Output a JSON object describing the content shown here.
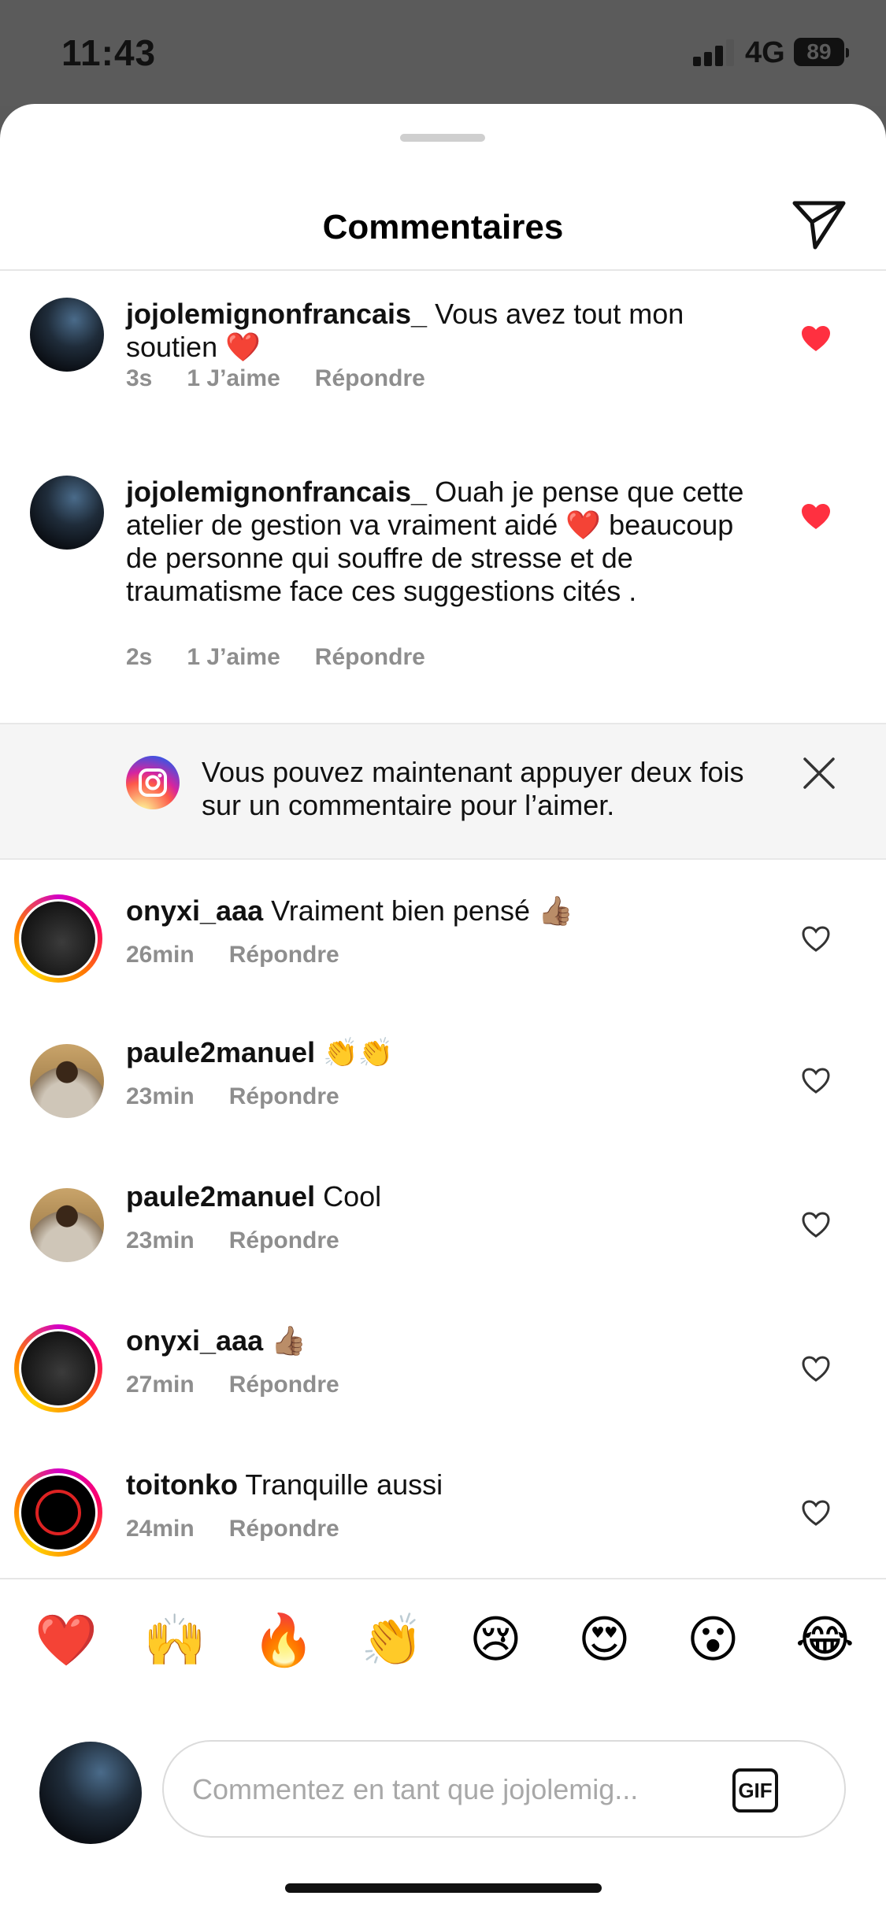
{
  "status": {
    "time": "11:43",
    "network": "4G",
    "battery": "89"
  },
  "header": {
    "title": "Commentaires",
    "share_icon": "paper-plane-icon"
  },
  "comments": [
    {
      "user": "jojolemignonfrancais_",
      "text": " Vous avez tout mon soutien ❤️",
      "time": "3s",
      "likes": "1 J’aime",
      "reply": "Répondre",
      "liked": true
    },
    {
      "user": "jojolemignonfrancais_",
      "text": " Ouah je pense que cette atelier de gestion va vraiment aidé ❤️ beaucoup de personne qui souffre de stresse et de traumatisme face ces suggestions cités .",
      "time": "2s",
      "likes": "1 J’aime",
      "reply": "Répondre",
      "liked": true
    },
    {
      "user": "onyxi_aaa",
      "text": " Vraiment bien pensé 👍🏽",
      "time": "26min",
      "reply": "Répondre",
      "liked": false
    },
    {
      "user": "paule2manuel",
      "text": " 👏👏",
      "time": "23min",
      "reply": "Répondre",
      "liked": false
    },
    {
      "user": "paule2manuel",
      "text": " Cool",
      "time": "23min",
      "reply": "Répondre",
      "liked": false
    },
    {
      "user": "onyxi_aaa",
      "text": " 👍🏽",
      "time": "27min",
      "reply": "Répondre",
      "liked": false
    },
    {
      "user": "toitonko",
      "text": " Tranquille aussi",
      "time": "24min",
      "reply": "Répondre",
      "liked": false
    }
  ],
  "notice": {
    "text": "Vous pouvez maintenant appuyer deux fois sur un commentaire pour l’aimer."
  },
  "emoji_bar": [
    "❤️",
    "🙌",
    "🔥",
    "👏",
    "😢",
    "😍",
    "😮",
    "😂"
  ],
  "composer": {
    "placeholder": "Commentez en tant que jojolemig...",
    "gif_label": "GIF"
  },
  "colors": {
    "like_red": "#ff3040",
    "meta_gray": "#8e8e8e"
  }
}
